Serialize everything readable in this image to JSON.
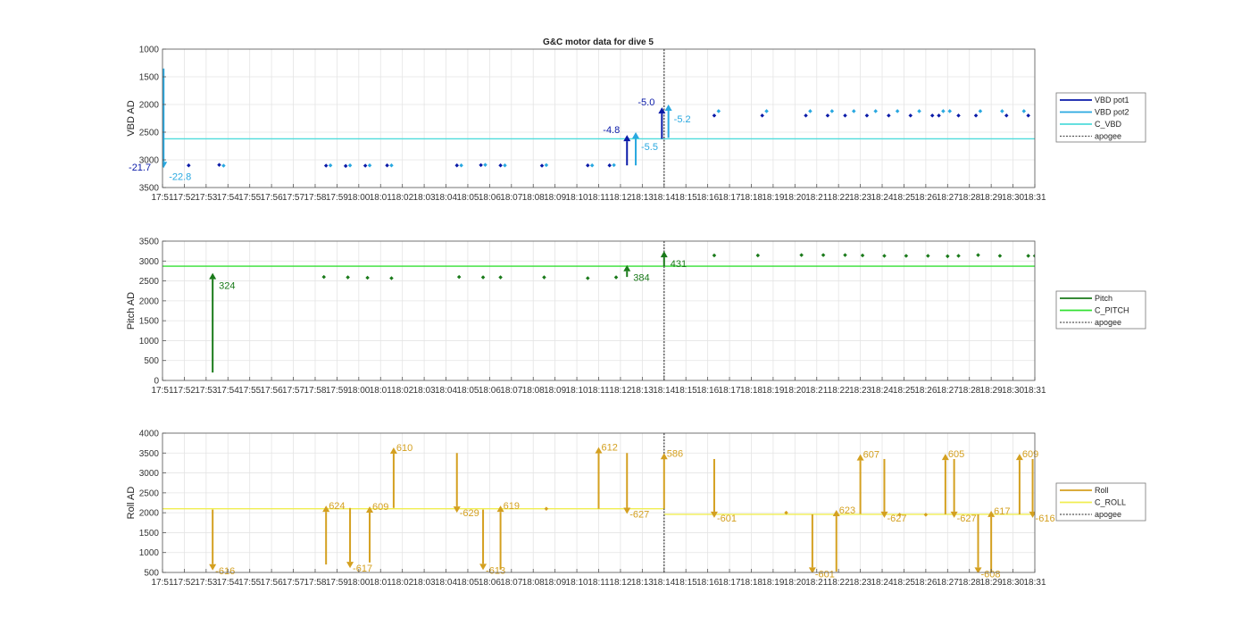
{
  "chart_data": [
    {
      "type": "line",
      "title": "G&C motor data for dive 5",
      "ylabel": "VBD AD",
      "ylim": [
        1000,
        3500
      ],
      "y_reversed": true,
      "yticks": [
        "1000",
        "1500",
        "2000",
        "2500",
        "3000",
        "3500"
      ],
      "xticks": [
        "17:51",
        "17:52",
        "17:53",
        "17:54",
        "17:55",
        "17:56",
        "17:57",
        "17:58",
        "17:59",
        "18:00",
        "18:01",
        "18:02",
        "18:03",
        "18:04",
        "18:05",
        "18:06",
        "18:07",
        "18:08",
        "18:09",
        "18:10",
        "18:11",
        "18:12",
        "18:13",
        "18:14",
        "18:15",
        "18:16",
        "18:17",
        "18:18",
        "18:19",
        "18:20",
        "18:21",
        "18:22",
        "18:23",
        "18:24",
        "18:25",
        "18:26",
        "18:27",
        "18:28",
        "18:29",
        "18:30",
        "18:31"
      ],
      "xlim_minutes": [
        0,
        40
      ],
      "grid": true,
      "legend_position": "outside-right",
      "legend": [
        "VBD pot1",
        "VBD pot2",
        "C_VBD",
        "apogee"
      ],
      "colors": {
        "pot1": "#0a1aa8",
        "pot2": "#29a8e0",
        "c_line": "#4fdcdc",
        "apogee": "#555555"
      },
      "apogee_minute": 23,
      "reference_value": 2620,
      "pot1_points": [
        [
          1.2,
          3100
        ],
        [
          2.6,
          3090
        ],
        [
          7.5,
          3105
        ],
        [
          8.4,
          3110
        ],
        [
          9.3,
          3105
        ],
        [
          10.3,
          3100
        ],
        [
          13.5,
          3100
        ],
        [
          14.6,
          3095
        ],
        [
          15.5,
          3100
        ],
        [
          17.4,
          3105
        ],
        [
          19.5,
          3100
        ],
        [
          20.5,
          3100
        ],
        [
          25.3,
          2200
        ],
        [
          27.5,
          2200
        ],
        [
          29.5,
          2200
        ],
        [
          30.5,
          2200
        ],
        [
          31.3,
          2200
        ],
        [
          32.3,
          2200
        ],
        [
          33.3,
          2200
        ],
        [
          34.3,
          2200
        ],
        [
          35.3,
          2200
        ],
        [
          35.6,
          2200
        ],
        [
          36.5,
          2200
        ],
        [
          37.3,
          2200
        ],
        [
          38.7,
          2200
        ],
        [
          39.7,
          2200
        ]
      ],
      "pot2_points": [
        [
          2.8,
          3105
        ],
        [
          7.7,
          3100
        ],
        [
          8.6,
          3100
        ],
        [
          9.5,
          3100
        ],
        [
          10.5,
          3100
        ],
        [
          13.7,
          3100
        ],
        [
          14.8,
          3090
        ],
        [
          15.7,
          3100
        ],
        [
          17.6,
          3095
        ],
        [
          19.7,
          3100
        ],
        [
          20.7,
          3095
        ],
        [
          25.5,
          2120
        ],
        [
          27.7,
          2120
        ],
        [
          29.7,
          2120
        ],
        [
          30.7,
          2120
        ],
        [
          31.7,
          2120
        ],
        [
          32.7,
          2120
        ],
        [
          33.7,
          2120
        ],
        [
          34.7,
          2120
        ],
        [
          35.8,
          2120
        ],
        [
          36.1,
          2120
        ],
        [
          37.5,
          2120
        ],
        [
          38.5,
          2120
        ],
        [
          39.5,
          2120
        ]
      ],
      "pot1_arrows": [
        {
          "x": -0.2,
          "from": 1450,
          "to": 3130,
          "label": "-21.7"
        },
        {
          "x": 21.3,
          "from": 3100,
          "to": 2550,
          "label": "-4.8"
        },
        {
          "x": 22.9,
          "from": 2620,
          "to": 2050,
          "label": "-5.0"
        }
      ],
      "pot2_arrows": [
        {
          "x": 0.05,
          "from": 1350,
          "to": 3150,
          "label": "-22.8"
        },
        {
          "x": 21.7,
          "from": 3100,
          "to": 2500,
          "label": "-5.5"
        },
        {
          "x": 23.2,
          "from": 2600,
          "to": 2000,
          "label": "-5.2"
        }
      ]
    },
    {
      "type": "line",
      "ylabel": "Pitch AD",
      "ylim": [
        0,
        3500
      ],
      "yticks": [
        "0",
        "500",
        "1000",
        "1500",
        "2000",
        "2500",
        "3000",
        "3500"
      ],
      "xticks": [
        "17:51",
        "17:52",
        "17:53",
        "17:54",
        "17:55",
        "17:56",
        "17:57",
        "17:58",
        "17:59",
        "18:00",
        "18:01",
        "18:02",
        "18:03",
        "18:04",
        "18:05",
        "18:06",
        "18:07",
        "18:08",
        "18:09",
        "18:10",
        "18:11",
        "18:12",
        "18:13",
        "18:14",
        "18:15",
        "18:16",
        "18:17",
        "18:18",
        "18:19",
        "18:20",
        "18:21",
        "18:22",
        "18:23",
        "18:24",
        "18:25",
        "18:26",
        "18:27",
        "18:28",
        "18:29",
        "18:30",
        "18:31"
      ],
      "xlim_minutes": [
        0,
        40
      ],
      "grid": true,
      "legend_position": "outside-right",
      "legend": [
        "Pitch",
        "C_PITCH",
        "apogee"
      ],
      "colors": {
        "pitch": "#1a7a1a",
        "c_line": "#33e033",
        "apogee": "#555555"
      },
      "apogee_minute": 23,
      "reference_value": 2870,
      "points": [
        [
          7.4,
          2600
        ],
        [
          8.5,
          2590
        ],
        [
          9.4,
          2580
        ],
        [
          10.5,
          2570
        ],
        [
          13.6,
          2600
        ],
        [
          14.7,
          2590
        ],
        [
          15.5,
          2590
        ],
        [
          17.5,
          2590
        ],
        [
          19.5,
          2570
        ],
        [
          20.8,
          2590
        ],
        [
          25.3,
          3140
        ],
        [
          27.3,
          3140
        ],
        [
          29.3,
          3150
        ],
        [
          30.3,
          3150
        ],
        [
          31.3,
          3150
        ],
        [
          32.1,
          3140
        ],
        [
          33.1,
          3130
        ],
        [
          34.1,
          3130
        ],
        [
          35.1,
          3130
        ],
        [
          36.0,
          3120
        ],
        [
          36.5,
          3130
        ],
        [
          37.4,
          3150
        ],
        [
          38.4,
          3130
        ],
        [
          39.7,
          3130
        ],
        [
          40.0,
          3130
        ]
      ],
      "arrows": [
        {
          "x": 2.3,
          "from": 200,
          "to": 2700,
          "label": "324"
        },
        {
          "x": 21.3,
          "from": 2600,
          "to": 2900,
          "label": "384"
        },
        {
          "x": 23.0,
          "from": 2870,
          "to": 3250,
          "label": "431"
        }
      ]
    },
    {
      "type": "line",
      "ylabel": "Roll AD",
      "ylim": [
        500,
        4000
      ],
      "yticks": [
        "500",
        "1000",
        "1500",
        "2000",
        "2500",
        "3000",
        "3500",
        "4000"
      ],
      "xticks": [
        "17:51",
        "17:52",
        "17:53",
        "17:54",
        "17:55",
        "17:56",
        "17:57",
        "17:58",
        "17:59",
        "18:00",
        "18:01",
        "18:02",
        "18:03",
        "18:04",
        "18:05",
        "18:06",
        "18:07",
        "18:08",
        "18:09",
        "18:10",
        "18:11",
        "18:12",
        "18:13",
        "18:14",
        "18:15",
        "18:16",
        "18:17",
        "18:18",
        "18:19",
        "18:20",
        "18:21",
        "18:22",
        "18:23",
        "18:24",
        "18:25",
        "18:26",
        "18:27",
        "18:28",
        "18:29",
        "18:30",
        "18:31"
      ],
      "xlim_minutes": [
        0,
        40
      ],
      "grid": true,
      "legend_position": "outside-right",
      "legend": [
        "Roll",
        "C_ROLL",
        "apogee"
      ],
      "colors": {
        "roll": "#d4a020",
        "c_line": "#f0ee50",
        "apogee": "#555555"
      },
      "apogee_minute": 23,
      "reference_segments": [
        {
          "from": 0,
          "to": 23,
          "value": 2100
        },
        {
          "from": 23,
          "to": 40,
          "value": 1960
        }
      ],
      "points": [
        [
          -0.2,
          2080
        ],
        [
          17.6,
          2100
        ],
        [
          28.6,
          2000
        ],
        [
          33.8,
          1950
        ],
        [
          35.0,
          1950
        ]
      ],
      "arrows": [
        {
          "x": 2.3,
          "from": 2080,
          "to": 550,
          "label": "-616"
        },
        {
          "x": 7.5,
          "from": 700,
          "to": 2180,
          "label": "624"
        },
        {
          "x": 8.6,
          "from": 2120,
          "to": 610,
          "label": "-617"
        },
        {
          "x": 9.5,
          "from": 750,
          "to": 2160,
          "label": "609"
        },
        {
          "x": 10.6,
          "from": 2120,
          "to": 3640,
          "label": "610"
        },
        {
          "x": 13.5,
          "from": 3500,
          "to": 2000,
          "label": "-629"
        },
        {
          "x": 14.7,
          "from": 2080,
          "to": 560,
          "label": "-613"
        },
        {
          "x": 15.5,
          "from": 570,
          "to": 2180,
          "label": "619"
        },
        {
          "x": 20.0,
          "from": 2100,
          "to": 3650,
          "label": "612"
        },
        {
          "x": 21.3,
          "from": 3500,
          "to": 1970,
          "label": "-627"
        },
        {
          "x": 23.0,
          "from": 2100,
          "to": 3500,
          "label": "586"
        },
        {
          "x": 25.3,
          "from": 3350,
          "to": 1870,
          "label": "-601"
        },
        {
          "x": 29.8,
          "from": 1960,
          "to": 470,
          "label": "-601"
        },
        {
          "x": 30.9,
          "from": 520,
          "to": 2070,
          "label": "623"
        },
        {
          "x": 32.0,
          "from": 1970,
          "to": 3470,
          "label": "607"
        },
        {
          "x": 33.1,
          "from": 3350,
          "to": 1870,
          "label": "-627"
        },
        {
          "x": 35.9,
          "from": 1960,
          "to": 3480,
          "label": "605"
        },
        {
          "x": 36.3,
          "from": 3350,
          "to": 1870,
          "label": "-627"
        },
        {
          "x": 37.4,
          "from": 1960,
          "to": 470,
          "label": "-608"
        },
        {
          "x": 38.0,
          "from": 480,
          "to": 2050,
          "label": "617"
        },
        {
          "x": 39.3,
          "from": 1960,
          "to": 3480,
          "label": "609"
        },
        {
          "x": 39.9,
          "from": 3350,
          "to": 1870,
          "label": "-616"
        }
      ]
    }
  ]
}
